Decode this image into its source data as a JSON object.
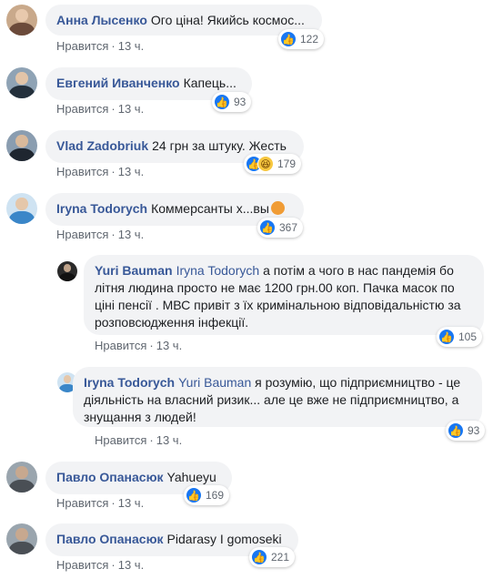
{
  "comments": [
    {
      "author": "Анна Лысенко",
      "text": "Ого ціна! Якийсь космос...",
      "like_label": "Нравится",
      "time": "13 ч.",
      "reactions": [
        "like-icon"
      ],
      "count": "122"
    },
    {
      "author": "Евгений Иванченко",
      "text": "Капець...",
      "like_label": "Нравится",
      "time": "13 ч.",
      "reactions": [
        "like-icon"
      ],
      "count": "93"
    },
    {
      "author": "Vlad Zadobriuk",
      "text": "24 грн за штуку. Жесть",
      "like_label": "Нравится",
      "time": "13 ч.",
      "reactions": [
        "like-icon",
        "haha-icon"
      ],
      "count": "179"
    },
    {
      "author": "Iryna Todorych",
      "text": "Коммерсанты х...вы",
      "emoji": "angry-face-emoji",
      "like_label": "Нравится",
      "time": "13 ч.",
      "reactions": [
        "like-icon"
      ],
      "count": "367"
    },
    {
      "author": "Yuri Bauman",
      "mention": "Iryna Todorych",
      "text": "а потім а чого в нас пандемія бо літня людина просто не має 1200 грн.00 коп. Пачка масок по ціні пенсії . МВС привіт з їх кримінальною відповідальністю за розповсюдження інфекції.",
      "like_label": "Нравится",
      "time": "13 ч.",
      "reactions": [
        "like-icon"
      ],
      "count": "105"
    },
    {
      "author": "Iryna Todorych",
      "mention": "Yuri Bauman",
      "text": "я розумію, що підприємництво - це діяльність на власний ризик... але це вже не підприємництво, а знущання з людей!",
      "like_label": "Нравится",
      "time": "13 ч.",
      "reactions": [
        "like-icon"
      ],
      "count": "93"
    },
    {
      "author": "Павло Опанасюк",
      "text": "Yahueyu",
      "like_label": "Нравится",
      "time": "13 ч.",
      "reactions": [
        "like-icon"
      ],
      "count": "169"
    },
    {
      "author": "Павло Опанасюк",
      "text": "Pidarasy I gomoseki",
      "like_label": "Нравится",
      "time": "13 ч.",
      "reactions": [
        "like-icon"
      ],
      "count": "221"
    }
  ],
  "colors": {
    "author": "#385898",
    "bubble": "#f2f3f5",
    "like": "#1877f2",
    "meta": "#606770"
  }
}
